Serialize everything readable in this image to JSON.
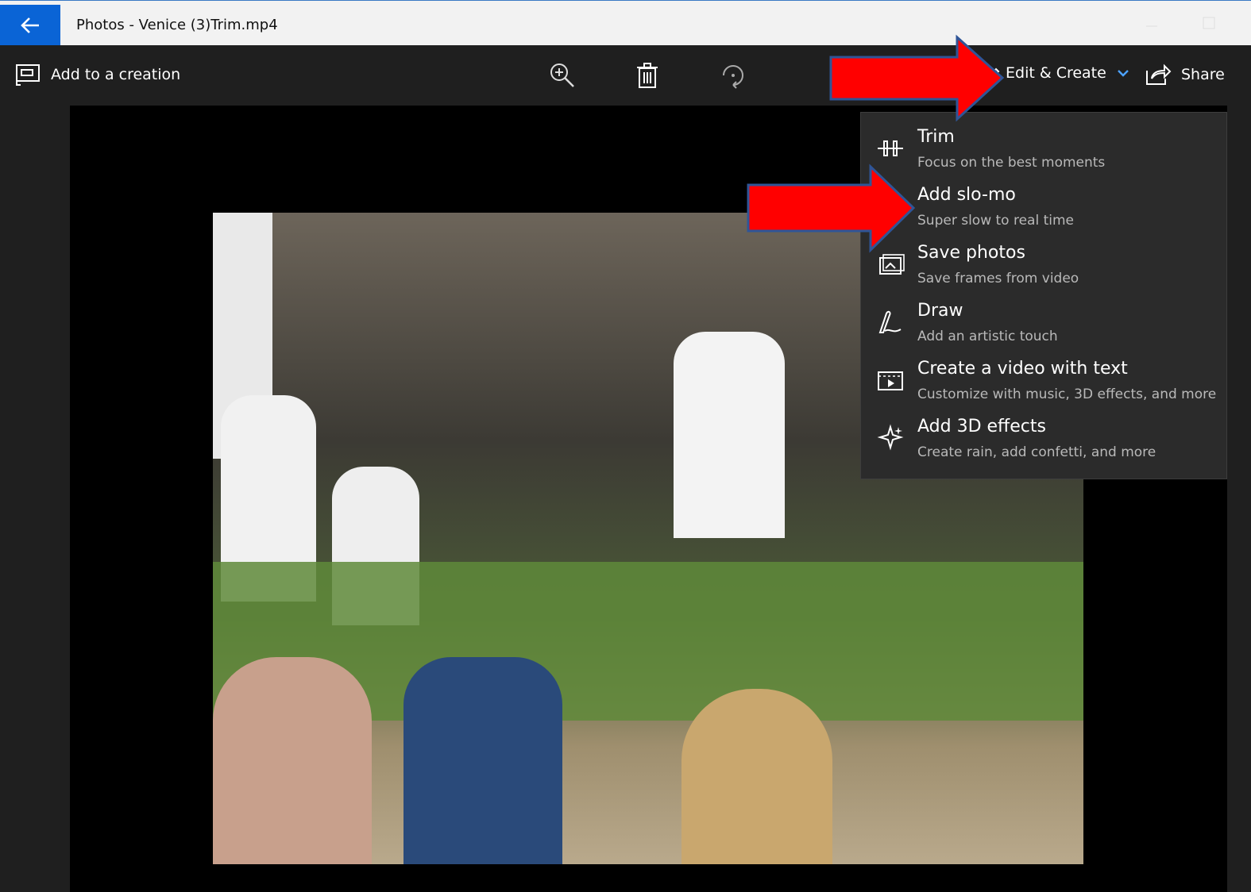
{
  "window": {
    "title": "Photos - Venice (3)Trim.mp4",
    "accent": "#0a64d6"
  },
  "toolbar": {
    "add_to_creation": "Add to a creation",
    "edit_create": "Edit & Create",
    "share": "Share",
    "icons": [
      "zoom-in-icon",
      "delete-icon",
      "rotate-icon"
    ]
  },
  "menu": {
    "items": [
      {
        "title": "Trim",
        "subtitle": "Focus on the best moments",
        "icon": "trim-icon"
      },
      {
        "title": "Add slo-mo",
        "subtitle": "Super slow to real time",
        "icon": "slo-mo-icon"
      },
      {
        "title": "Save photos",
        "subtitle": "Save frames from video",
        "icon": "save-photos-icon"
      },
      {
        "title": "Draw",
        "subtitle": "Add an artistic touch",
        "icon": "draw-icon"
      },
      {
        "title": "Create a video with text",
        "subtitle": "Customize with music, 3D effects, and more",
        "icon": "video-text-icon"
      },
      {
        "title": "Add 3D effects",
        "subtitle": "Create rain, add confetti, and more",
        "icon": "3d-effects-icon"
      }
    ]
  },
  "annotation": {
    "arrow_color": "#ff0000",
    "arrow_border": "#2f5597"
  }
}
